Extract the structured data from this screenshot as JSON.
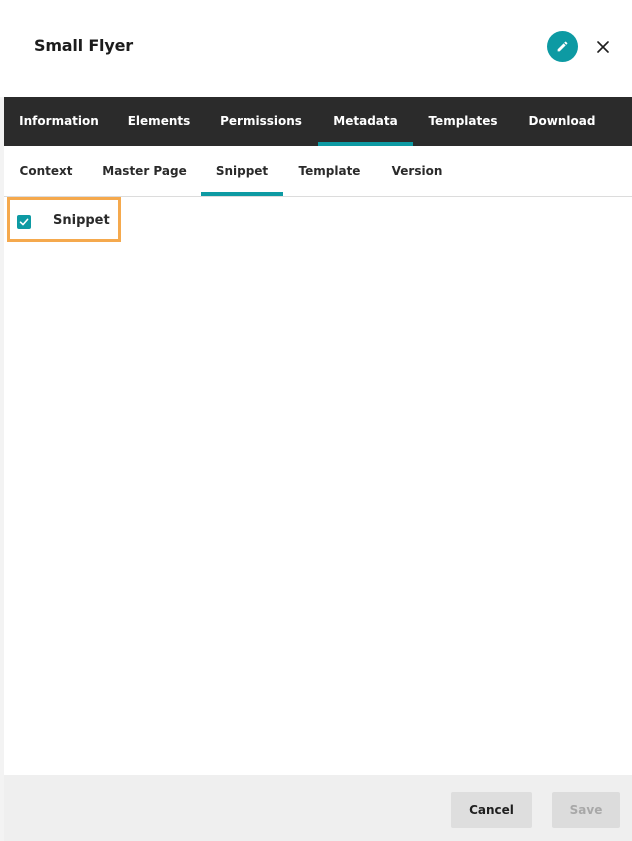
{
  "dialog": {
    "title": "Small Flyer",
    "edit_icon": "pencil-icon",
    "close_icon": "close-icon"
  },
  "primary_tabs": {
    "items": [
      {
        "label": "Information",
        "active": false
      },
      {
        "label": "Elements",
        "active": false
      },
      {
        "label": "Permissions",
        "active": false
      },
      {
        "label": "Metadata",
        "active": true
      },
      {
        "label": "Templates",
        "active": false
      },
      {
        "label": "Download",
        "active": false
      }
    ]
  },
  "secondary_tabs": {
    "items": [
      {
        "label": "Context",
        "active": false
      },
      {
        "label": "Master Page",
        "active": false
      },
      {
        "label": "Snippet",
        "active": true
      },
      {
        "label": "Template",
        "active": false
      },
      {
        "label": "Version",
        "active": false
      }
    ]
  },
  "content": {
    "snippet_checkbox": {
      "label": "Snippet",
      "checked": true,
      "icon": "check-icon"
    }
  },
  "footer": {
    "cancel_label": "Cancel",
    "save_label": "Save",
    "save_disabled": true
  },
  "colors": {
    "accent": "#0d9aa3",
    "tab_bar": "#2b2b2b",
    "highlight_border": "#f5a94d"
  }
}
